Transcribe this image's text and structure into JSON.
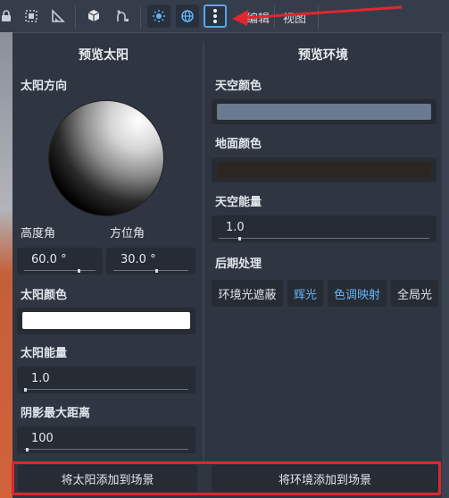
{
  "toolbar": {
    "icons": [
      "lock-icon",
      "group-icon",
      "ruler-icon",
      "cube-icon",
      "snap-icon",
      "sun-icon",
      "globe-icon",
      "more-icon"
    ],
    "menu_partial_1": "编辑",
    "menu_partial_2": "视图"
  },
  "sun_panel": {
    "title": "预览太阳",
    "direction_label": "太阳方向",
    "elevation_label": "高度角",
    "elevation_value": "60.0 °",
    "azimuth_label": "方位角",
    "azimuth_value": "30.0 °",
    "color_label": "太阳颜色",
    "color_value": "#ffffff",
    "energy_label": "太阳能量",
    "energy_value": "1.0",
    "shadow_label": "阴影最大距离",
    "shadow_value": "100",
    "add_button": "将太阳添加到场景"
  },
  "env_panel": {
    "title": "预览环境",
    "sky_color_label": "天空颜色",
    "sky_color_value": "#6a7a91",
    "ground_color_label": "地面颜色",
    "ground_color_value": "#2c2622",
    "sky_energy_label": "天空能量",
    "sky_energy_value": "1.0",
    "post_label": "后期处理",
    "post_buttons": [
      {
        "label": "环境光遮蔽",
        "active": false
      },
      {
        "label": "辉光",
        "active": true
      },
      {
        "label": "色调映射",
        "active": true
      },
      {
        "label": "全局光",
        "active": false
      }
    ],
    "add_button": "将环境添加到场景"
  },
  "colors": {
    "accent": "#5aa6e6",
    "highlight_red": "#e0262e"
  }
}
